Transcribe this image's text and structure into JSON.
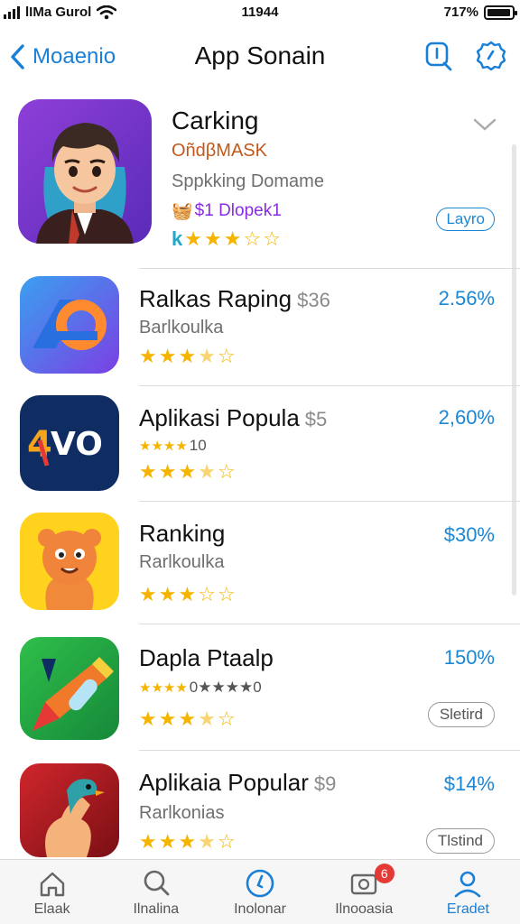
{
  "status_bar": {
    "carrier": "lIMa Gurol",
    "time": "11944",
    "battery_text": "717%",
    "battery_level": 0.95
  },
  "nav": {
    "back_label": "Moaenio",
    "title": "App Sonain",
    "icons": [
      "search-icon",
      "settings-icon"
    ]
  },
  "featured": {
    "title": "Carking",
    "developer": "OñdβMASK",
    "subtitle": "Sppkking Domame",
    "price_line": "$1 Dlopek1",
    "rating_prefix": "k",
    "rating": 3,
    "max_rating": 5,
    "pill_label": "Layro",
    "icon": "avatar-boy-icon"
  },
  "apps": [
    {
      "title": "Ralkas Raping",
      "price": "$36",
      "subtitle": "Barlkoulka",
      "extra": "",
      "rating": 3.5,
      "percent": "2.56%",
      "pill": "",
      "icon": "ap-logo-icon"
    },
    {
      "title": "Aplikasi Popula",
      "price": "$5",
      "subtitle": "",
      "extra": "10",
      "rating": 3.5,
      "percent": "2,60%",
      "pill": "",
      "icon": "4vo-logo-icon"
    },
    {
      "title": "Ranking",
      "price": "",
      "subtitle": "Rarlkoulka",
      "extra": "",
      "rating": 3,
      "percent": "$30%",
      "pill": "",
      "icon": "orange-creature-icon"
    },
    {
      "title": "Dapla Ptaalp",
      "price": "",
      "subtitle": "",
      "extra": "0★★★★0",
      "rating": 3.5,
      "percent": "150%",
      "pill": "Sletird",
      "icon": "pencil-logo-icon"
    },
    {
      "title": "Aplikaia Popular",
      "price": "$9",
      "subtitle": "Rarlkonias",
      "extra": "",
      "rating": 3.5,
      "percent": "$14%",
      "pill": "Tlstind",
      "icon": "bird-hand-icon"
    }
  ],
  "tabs": [
    {
      "label": "Elaak",
      "icon": "home-icon",
      "badge": ""
    },
    {
      "label": "Ilnalina",
      "icon": "search-icon",
      "badge": ""
    },
    {
      "label": "Inolonar",
      "icon": "clock-icon",
      "badge": ""
    },
    {
      "label": "Ilnooasia",
      "icon": "inbox-icon",
      "badge": "6"
    },
    {
      "label": "Eradet",
      "icon": "profile-icon",
      "badge": ""
    }
  ],
  "colors": {
    "accent": "#1a7fd6",
    "star": "#f4b400",
    "badge": "#e53935"
  }
}
